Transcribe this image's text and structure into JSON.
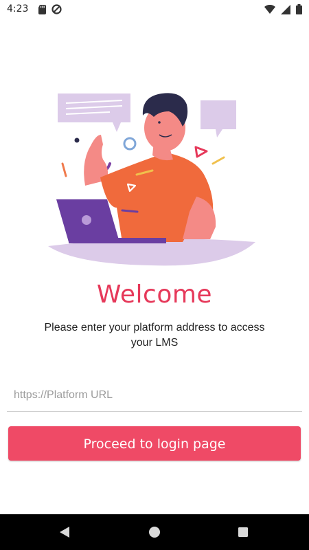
{
  "status_bar": {
    "time": "4:23",
    "icons": [
      "sd-card-icon",
      "data-saver-icon",
      "wifi-icon",
      "signal-icon",
      "battery-icon"
    ]
  },
  "main": {
    "illustration": "person-with-laptop-illustration",
    "title": "Welcome",
    "subtitle": "Please enter your platform address to access your LMS",
    "url_input": {
      "placeholder": "https://Platform URL",
      "value": ""
    },
    "proceed_button_label": "Proceed to login page"
  },
  "nav_bar": {
    "icons": [
      "back-icon",
      "home-icon",
      "recents-icon"
    ]
  },
  "colors": {
    "accent": "#e6395a",
    "button": "#ef4a66",
    "shirt": "#f06a3c",
    "laptop": "#6a3ea1",
    "bubble": "#d9c7ea"
  }
}
